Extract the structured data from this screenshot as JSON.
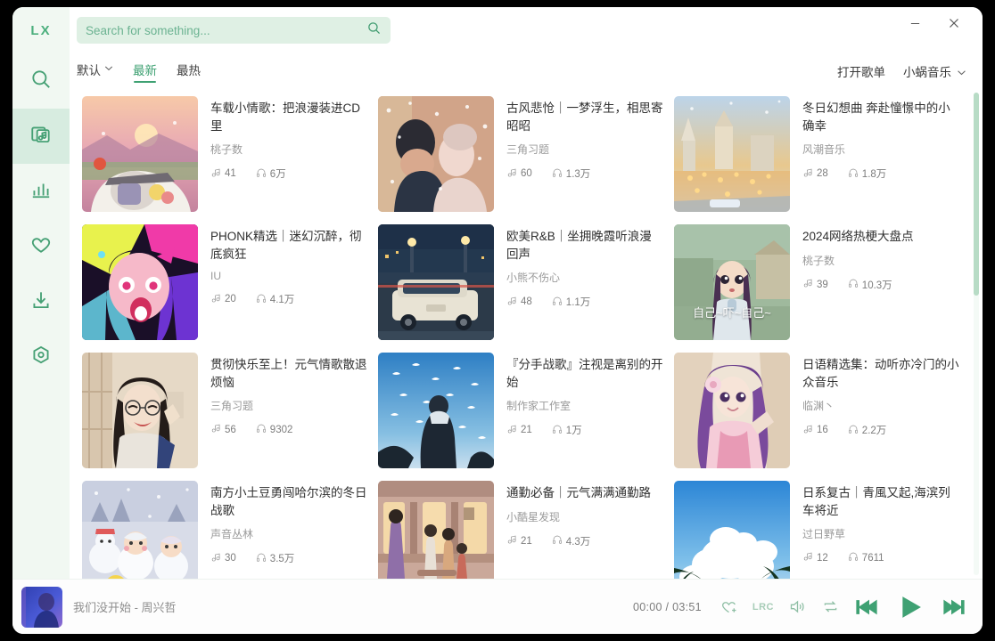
{
  "app": {
    "logo": "LX",
    "window_controls": {
      "minimize": "minimize-icon",
      "close": "close-icon"
    }
  },
  "sidebar": {
    "items": [
      {
        "name": "search",
        "icon": "search-icon",
        "active": false
      },
      {
        "name": "library",
        "icon": "music-library-icon",
        "active": true
      },
      {
        "name": "ranking",
        "icon": "bar-chart-icon",
        "active": false
      },
      {
        "name": "favorites",
        "icon": "heart-icon",
        "active": false
      },
      {
        "name": "downloads",
        "icon": "download-icon",
        "active": false
      },
      {
        "name": "settings",
        "icon": "settings-icon",
        "active": false
      }
    ]
  },
  "search": {
    "placeholder": "Search for something...",
    "value": "",
    "icon": "search-icon"
  },
  "filters": {
    "sort": {
      "label": "默认",
      "caret": "⌄"
    },
    "tabs": [
      {
        "label": "最新",
        "active": true
      },
      {
        "label": "最热",
        "active": false
      }
    ],
    "open_playlist": "打开歌单",
    "source": {
      "label": "小蜗音乐",
      "caret": "⌄"
    }
  },
  "cards": [
    {
      "title": "车载小情歌：把浪漫装进CD里",
      "author": "桃子数",
      "songs": "41",
      "plays": "6万",
      "overlay": ""
    },
    {
      "title": "古风悲怆｜一梦浮生，相思寄昭昭",
      "author": "三角习题",
      "songs": "60",
      "plays": "1.3万",
      "overlay": ""
    },
    {
      "title": "冬日幻想曲 奔赴憧憬中的小确幸",
      "author": "风潮音乐",
      "songs": "28",
      "plays": "1.8万",
      "overlay": ""
    },
    {
      "title": "PHONK精选｜迷幻沉醉，彻底疯狂",
      "author": "IU",
      "songs": "20",
      "plays": "4.1万",
      "overlay": ""
    },
    {
      "title": "欧美R&B｜坐拥晚霞听浪漫回声",
      "author": "小熊不伤心",
      "songs": "48",
      "plays": "1.1万",
      "overlay": ""
    },
    {
      "title": "2024网络热梗大盘点",
      "author": "桃子数",
      "songs": "39",
      "plays": "10.3万",
      "overlay": "自己~吓~自己~"
    },
    {
      "title": "贯彻快乐至上！元气情歌散退烦恼",
      "author": "三角习题",
      "songs": "56",
      "plays": "9302",
      "overlay": ""
    },
    {
      "title": "『分手战歌』注视是离别的开始",
      "author": "制作家工作室",
      "songs": "21",
      "plays": "1万",
      "overlay": ""
    },
    {
      "title": "日语精选集：动听亦冷门的小众音乐",
      "author": "临渊丶",
      "songs": "16",
      "plays": "2.2万",
      "overlay": ""
    },
    {
      "title": "南方小土豆勇闯哈尔滨的冬日战歌",
      "author": "声音丛林",
      "songs": "30",
      "plays": "3.5万",
      "overlay": ""
    },
    {
      "title": "通勤必备｜元气满满通勤路",
      "author": "小酷星发现",
      "songs": "21",
      "plays": "4.3万",
      "overlay": ""
    },
    {
      "title": "日系复古｜青風又起,海滨列车将近",
      "author": "过日野草",
      "songs": "12",
      "plays": "7611",
      "overlay": ""
    }
  ],
  "player": {
    "now_playing": "我们没开始 - 周兴哲",
    "current_time": "00:00",
    "total_time": "03:51",
    "time_display": "00:00 / 03:51",
    "lrc_label": "LRC",
    "controls": [
      "favorite-icon",
      "lyrics-icon",
      "volume-icon",
      "repeat-icon",
      "previous-icon",
      "play-icon",
      "next-icon"
    ]
  },
  "colors": {
    "accent": "#3fa173",
    "sidebar_bg": "#f1f8f2",
    "search_bg": "#dff0e4",
    "active_nav_bg": "#d7ece0"
  }
}
